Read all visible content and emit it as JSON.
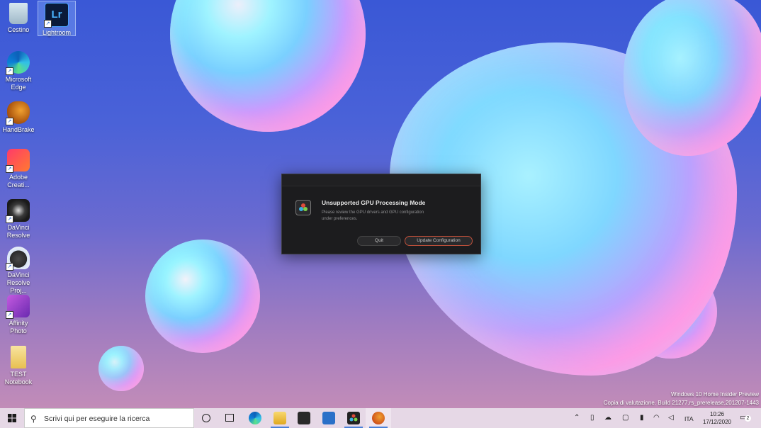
{
  "desktop": {
    "icons": [
      {
        "label": "Cestino"
      },
      {
        "label": "Lightroom",
        "glyph": "Lr"
      },
      {
        "label": "Microsoft Edge"
      },
      {
        "label": "HandBrake"
      },
      {
        "label": "Adobe Creati..."
      },
      {
        "label": "DaVinci Resolve"
      },
      {
        "label": "DaVinci Resolve Proj..."
      },
      {
        "label": "Affinity Photo"
      },
      {
        "label": "TEST Notebook"
      }
    ],
    "watermark": {
      "line1": "Windows 10 Home Insider Preview",
      "line2": "Copia di valutazione. Build 21277.rs_prerelease.201207-1443"
    }
  },
  "dialog": {
    "title": "Unsupported GPU Processing Mode",
    "message": "Please review the GPU drivers and GPU configuration under preferences.",
    "quit_label": "Quit",
    "update_label": "Update Configuration",
    "accent_color": "#c0503a"
  },
  "taskbar": {
    "search_placeholder": "Scrivi qui per eseguire la ricerca",
    "language": "ITA",
    "time": "10:26",
    "date": "17/12/2020",
    "notification_count": "2"
  }
}
